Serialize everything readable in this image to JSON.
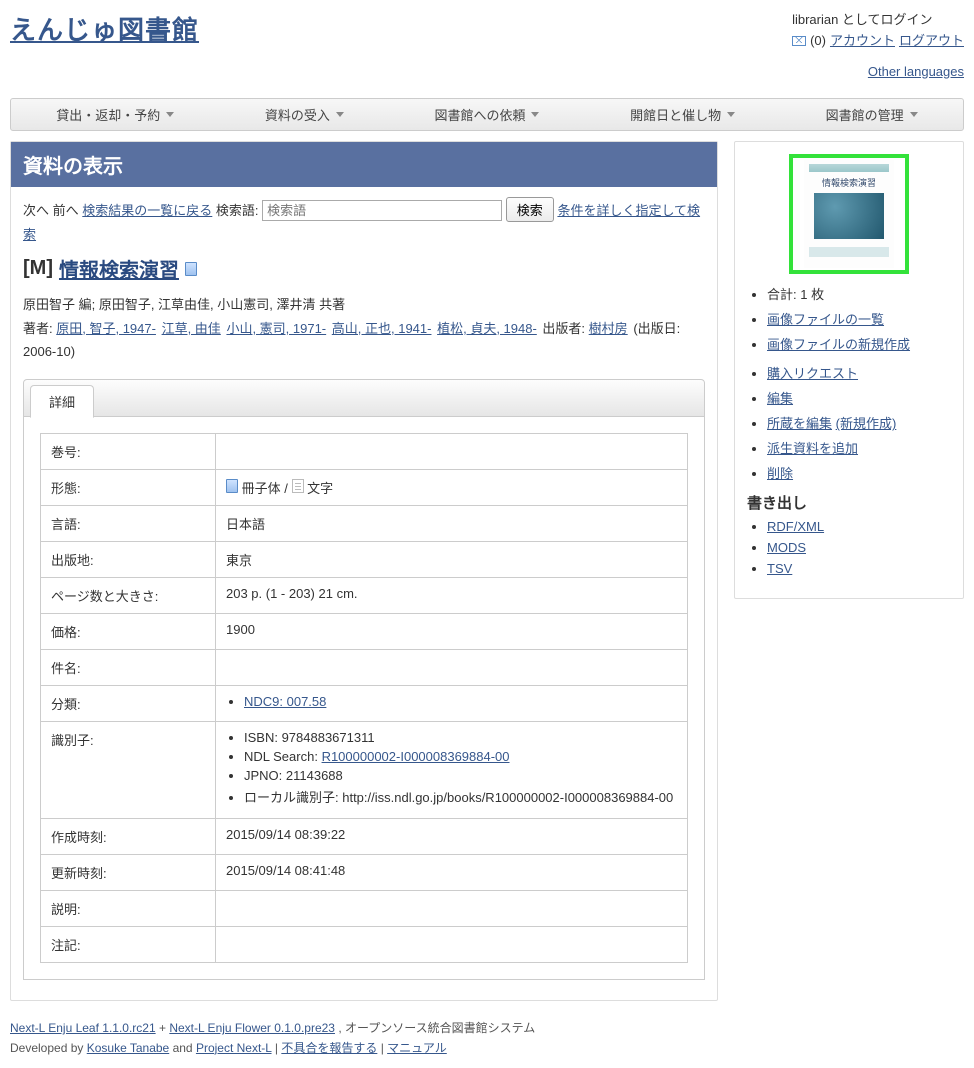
{
  "site": {
    "title": "えんじゅ図書館"
  },
  "user": {
    "logged_in_as": "librarian としてログイン",
    "message_count": "(0)",
    "account": "アカウント",
    "logout": "ログアウト",
    "other_languages": "Other languages"
  },
  "nav": {
    "items": [
      "貸出・返却・予約",
      "資料の受入",
      "図書館への依頼",
      "開館日と催し物",
      "図書館の管理"
    ]
  },
  "panel": {
    "title": "資料の表示"
  },
  "search": {
    "prev": "次へ",
    "next": "前へ",
    "back_to_results": "検索結果の一覧に戻る",
    "label": "検索語:",
    "placeholder": "検索語",
    "button": "検索",
    "advanced": "条件を詳しく指定して検索"
  },
  "record": {
    "prefix": "[M]",
    "title": "情報検索演習",
    "statement": "原田智子 編; 原田智子, 江草由佳, 小山憲司, 澤井清 共著",
    "authors_label": "著者:",
    "authors": [
      "原田, 智子, 1947-",
      "江草, 由佳",
      "小山, 憲司, 1971-",
      "高山, 正也, 1941-",
      "植松, 貞夫, 1948-"
    ],
    "publisher_label": "出版者:",
    "publisher": "樹村房",
    "pub_date_label": "(出版日:",
    "pub_date": "2006-10)"
  },
  "tabs": {
    "detail": "詳細"
  },
  "details": {
    "rows": {
      "volume": {
        "label": "巻号:",
        "value": ""
      },
      "form": {
        "label": "形態:",
        "form_text": "冊子体",
        "sep": "/",
        "text_type": "文字"
      },
      "language": {
        "label": "言語:",
        "value": "日本語"
      },
      "place": {
        "label": "出版地:",
        "value": "東京"
      },
      "extent": {
        "label": "ページ数と大きさ:",
        "value": "203 p. (1 - 203) 21 cm."
      },
      "price": {
        "label": "価格:",
        "value": "1900"
      },
      "subject": {
        "label": "件名:",
        "value": ""
      },
      "classification": {
        "label": "分類:",
        "ndc9": "NDC9: 007.58"
      },
      "identifiers": {
        "label": "識別子:",
        "isbn": "ISBN: 9784883671311",
        "ndl_label": "NDL Search:",
        "ndl_link": "R100000002-I000008369884-00",
        "jpno": "JPNO: 21143688",
        "local": "ローカル識別子: http://iss.ndl.go.jp/books/R100000002-I000008369884-00"
      },
      "created": {
        "label": "作成時刻:",
        "value": "2015/09/14 08:39:22"
      },
      "updated": {
        "label": "更新時刻:",
        "value": "2015/09/14 08:41:48"
      },
      "description": {
        "label": "説明:",
        "value": ""
      },
      "note": {
        "label": "注記:",
        "value": ""
      }
    }
  },
  "sidebar": {
    "cover_title": "情報検索演習",
    "total": "合計: 1 枚",
    "image_list": "画像ファイルの一覧",
    "image_new": "画像ファイルの新規作成",
    "purchase_request": "購入リクエスト",
    "edit": "編集",
    "holdings_edit": "所蔵を編集",
    "holdings_new": "(新規作成)",
    "derived_add": "派生資料を追加",
    "delete": "削除",
    "export_title": "書き出し",
    "rdf": "RDF/XML",
    "mods": "MODS",
    "tsv": "TSV"
  },
  "footer": {
    "leaf": "Next-L Enju Leaf 1.1.0.rc21",
    "plus": " + ",
    "flower": "Next-L Enju Flower 0.1.0.pre23",
    "tagline": ", オープンソース統合図書館システム",
    "dev_by": "Developed by ",
    "kosuke": "Kosuke Tanabe",
    "and": " and ",
    "project": "Project Next-L",
    "sep": " | ",
    "bug": "不具合を報告する",
    "manual": "マニュアル"
  }
}
